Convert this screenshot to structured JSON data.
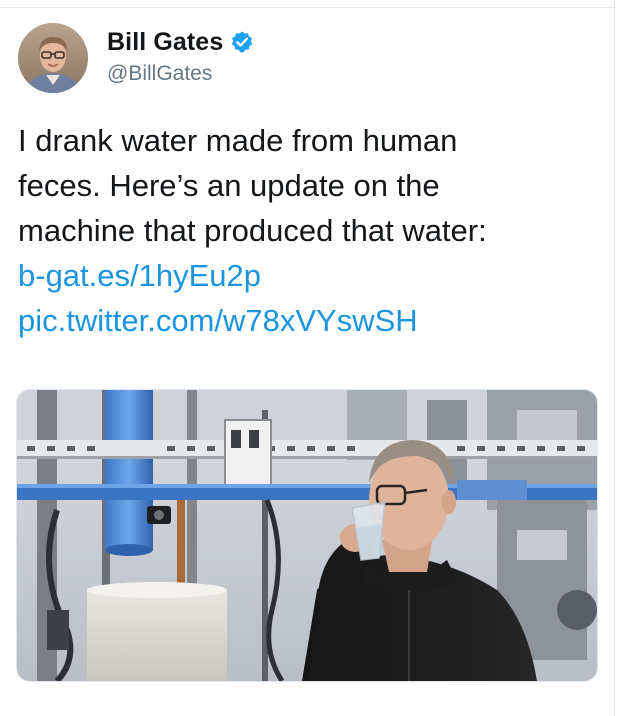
{
  "tweet": {
    "author": {
      "display_name": "Bill Gates",
      "handle": "@BillGates",
      "verified": true,
      "verified_icon": "verified-badge-icon",
      "avatar_icon": "profile-photo"
    },
    "text_lines": [
      "I drank water made from human",
      "feces. Here’s an update on the",
      "machine that produced that water:"
    ],
    "links": [
      "b-gat.es/1hyEu2p",
      "pic.twitter.com/w78xVYswSH"
    ],
    "media": {
      "kind": "photo"
    }
  },
  "colors": {
    "text": "#14171a",
    "secondary_text": "#657786",
    "link": "#1b95e0",
    "verified": "#1da1f2",
    "border": "#e6ecf0"
  }
}
